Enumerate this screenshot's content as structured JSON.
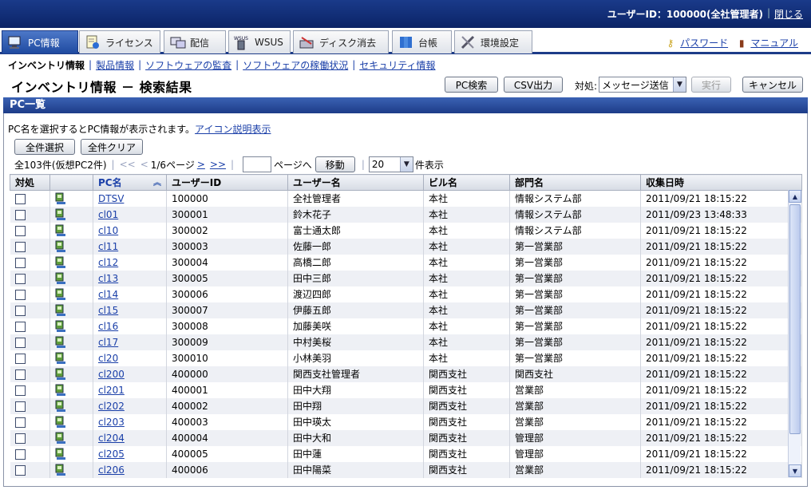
{
  "header": {
    "user_label": "ユーザーID：100000(全社管理者)",
    "close_link": "閉じる"
  },
  "tabs": [
    {
      "label": "PC情報",
      "icon": "pc-icon",
      "active": true
    },
    {
      "label": "ライセンス",
      "icon": "license-icon"
    },
    {
      "label": "配信",
      "icon": "distribution-icon"
    },
    {
      "label": "WSUS",
      "icon": "wsus-icon",
      "badge": "WSUS"
    },
    {
      "label": "ディスク消去",
      "icon": "disk-erase-icon"
    },
    {
      "label": "台帳",
      "icon": "ledger-icon"
    },
    {
      "label": "環境設定",
      "icon": "tools-icon"
    }
  ],
  "header_links": {
    "password": "パスワード",
    "manual": "マニュアル"
  },
  "subnav": {
    "current": "インベントリ情報",
    "links": [
      "製品情報",
      "ソフトウェアの監査",
      "ソフトウェアの稼働状況",
      "セキュリティ情報"
    ]
  },
  "page": {
    "title": "インベントリ情報 － 検索結果",
    "pc_search_button": "PC検索",
    "csv_button": "CSV出力",
    "action_label": "対処:",
    "action_select": "メッセージ送信",
    "execute_button": "実行",
    "cancel_button": "キャンセル"
  },
  "panel": {
    "title": "PC一覧",
    "description": "PC名を選択するとPC情報が表示されます。",
    "icon_help_link": "アイコン説明表示",
    "select_all": "全件選択",
    "clear_all": "全件クリア",
    "total": "全103件(仮想PC2件)",
    "first": "<<",
    "prev": "<",
    "page_info": "1/6ページ",
    "next": ">",
    "last": ">>",
    "goto_suffix": "ページへ",
    "move_button": "移動",
    "page_size": "20",
    "page_size_suffix": "件表示"
  },
  "table": {
    "columns": [
      "対処",
      "",
      "PC名",
      "ユーザーID",
      "ユーザー名",
      "ビル名",
      "部門名",
      "収集日時"
    ],
    "rows": [
      [
        "DTSV",
        "100000",
        "全社管理者",
        "本社",
        "情報システム部",
        "2011/09/21 18:15:22"
      ],
      [
        "cl01",
        "300001",
        "鈴木花子",
        "本社",
        "情報システム部",
        "2011/09/23 13:48:33"
      ],
      [
        "cl10",
        "300002",
        "富士通太郎",
        "本社",
        "情報システム部",
        "2011/09/21 18:15:22"
      ],
      [
        "cl11",
        "300003",
        "佐藤一郎",
        "本社",
        "第一営業部",
        "2011/09/21 18:15:22"
      ],
      [
        "cl12",
        "300004",
        "高橋二郎",
        "本社",
        "第一営業部",
        "2011/09/21 18:15:22"
      ],
      [
        "cl13",
        "300005",
        "田中三郎",
        "本社",
        "第一営業部",
        "2011/09/21 18:15:22"
      ],
      [
        "cl14",
        "300006",
        "渡辺四郎",
        "本社",
        "第一営業部",
        "2011/09/21 18:15:22"
      ],
      [
        "cl15",
        "300007",
        "伊藤五郎",
        "本社",
        "第一営業部",
        "2011/09/21 18:15:22"
      ],
      [
        "cl16",
        "300008",
        "加藤美咲",
        "本社",
        "第一営業部",
        "2011/09/21 18:15:22"
      ],
      [
        "cl17",
        "300009",
        "中村美桜",
        "本社",
        "第一営業部",
        "2011/09/21 18:15:22"
      ],
      [
        "cl20",
        "300010",
        "小林美羽",
        "本社",
        "第一営業部",
        "2011/09/21 18:15:22"
      ],
      [
        "cl200",
        "400000",
        "関西支社管理者",
        "関西支社",
        "関西支社",
        "2011/09/21 18:15:22"
      ],
      [
        "cl201",
        "400001",
        "田中大翔",
        "関西支社",
        "営業部",
        "2011/09/21 18:15:22"
      ],
      [
        "cl202",
        "400002",
        "田中翔",
        "関西支社",
        "営業部",
        "2011/09/21 18:15:22"
      ],
      [
        "cl203",
        "400003",
        "田中瑛太",
        "関西支社",
        "営業部",
        "2011/09/21 18:15:22"
      ],
      [
        "cl204",
        "400004",
        "田中大和",
        "関西支社",
        "管理部",
        "2011/09/21 18:15:22"
      ],
      [
        "cl205",
        "400005",
        "田中蓮",
        "関西支社",
        "管理部",
        "2011/09/21 18:15:22"
      ],
      [
        "cl206",
        "400006",
        "田中陽菜",
        "関西支社",
        "営業部",
        "2011/09/21 18:15:22"
      ]
    ]
  }
}
